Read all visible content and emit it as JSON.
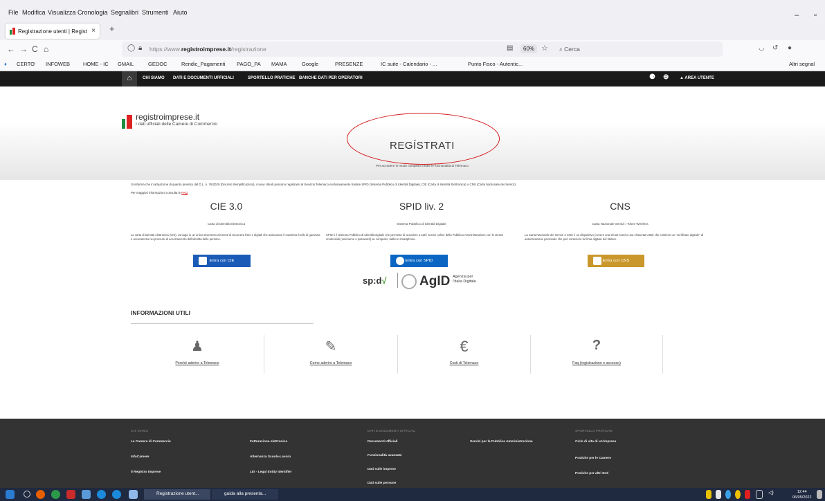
{
  "menu": [
    "File",
    "Modifica",
    "Visualizza",
    "Cronologia",
    "Segnalibri",
    "Strumenti",
    "Aiuto"
  ],
  "window_controls": {
    "minimize": "–",
    "restore": "ⓘ"
  },
  "tab": {
    "title": "Registrazione utenti | Registro Imprese",
    "close": "×",
    "new": "+"
  },
  "nav": {
    "back": "←",
    "forward": "→",
    "reload": "C",
    "home": "⌂",
    "url_prefix": "https://www.",
    "url_host": "registroimprese.it",
    "url_path": "/registrazione",
    "zoom": "60%",
    "search_placeholder": "Cerca"
  },
  "bookmarks": [
    "CERTO'",
    "INFOWEB",
    "HOME - IC",
    "GMAIL",
    "GEDOC",
    "Rendic_Pagamenti",
    "PAGO_PA",
    "MAMA",
    "Google",
    "PRESENZE",
    "IC suite - Calendario - ...",
    "Punto Fisco - Autentic..."
  ],
  "bookmarks_other": "Altri segnal",
  "site_nav": {
    "items": [
      "CHI SIAMO",
      "DATI E DOCUMENTI UFFICIALI",
      "SPORTELLO PRATICHE",
      "BANCHE DATI PER OPERATORI"
    ],
    "area": "AREA UTENTE"
  },
  "logo": {
    "name": "registroimprese.it",
    "tagline": "I dati ufficiali delle Camere di Commercio"
  },
  "hero": {
    "title": "REGÍSTRATI",
    "subtitle": "Per accedere in modo completo a tutte le funzionalità di Telemaco"
  },
  "info": {
    "line1": "Si informa che in attuazione di quanto previsto dal D.L. n. 76/2020 (Decreto Semplificazioni), i nuovi Utenti possono registrarsi al Servizio Telemaco esclusivamente tramite SPID (Sistema Pubblico di Identità Digitale), CIE (Carta di Identità Elettronica) o CNS (Carta Nazionale dei Servizi).",
    "line2": "Per maggiori informazioni consulta le",
    "faq": "FAQ"
  },
  "methods": [
    {
      "title": "CIE 3.0",
      "subtitle": "Carta di Identità Elettronica",
      "desc": "La carta di identità elettronica (CIE), coniuga in un unico strumento elementi di sicurezza fisici e digitali che assicurano il massimo livello di garanzia e accuratezza nei processi di accertamento dell'identità delle persone.",
      "button": "Entra con CIE",
      "color": "#1a5bb8"
    },
    {
      "title": "SPID liv. 2",
      "subtitle": "Sistema Pubblico di Identità Digitale",
      "desc": "SPID è il Sistema Pubblico di Identità Digitale che permette di accedere a tutti i servizi online della Pubblica Amministrazione con le stesse credenziali (username e password) su computer, tablet e smartphone.",
      "button": "Entra con SPID",
      "color": "#0a66c2"
    },
    {
      "title": "CNS",
      "subtitle": "Carta Nazionale Servizi / Token Wireless",
      "desc": "La Carta Nazionale dei Servizi o CNS è un dispositivo (ovvero una Smart Card o una chiavetta USB) che contiene un \"certificato digitale\" di autenticazione personale che può contenere la firma digitale del titolare.",
      "button": "Entra con CNS",
      "color": "#c9972b"
    }
  ],
  "logos": {
    "spid": "sp:d",
    "agid": "AgID",
    "agid_sub1": "Agenzia per",
    "agid_sub2": "l'Italia Digitale"
  },
  "useful": {
    "title": "INFORMAZIONI UTILI",
    "cards": [
      {
        "label": "Perché aderire a Telemaco",
        "icon": "user-cog-icon"
      },
      {
        "label": "Come aderire a Telemaco",
        "icon": "edit-form-icon"
      },
      {
        "label": "Costi di Telemaco",
        "icon": "euro-icon"
      },
      {
        "label": "Faq (registrazione e accesso)",
        "icon": "question-icon"
      }
    ]
  },
  "footer": {
    "heads": [
      "CHI SIAMO",
      "DATI E DOCUMENTI UFFICIALI",
      "SPORTELLO PRATICHE"
    ],
    "col1": [
      "Le Camere di Commercio",
      "InfoCamere",
      "Il Registro Imprese"
    ],
    "col2": [
      "Fatturazione elettronica",
      "Alternanza Scuola-Lavoro",
      "LEI - Legal Entity Identifier"
    ],
    "col3": [
      "Documenti Ufficiali",
      "Funzionalità avanzate",
      "Dati sulle imprese",
      "Dati sulle persone"
    ],
    "col4": [
      "Servizi per la Pubblica Amministrazione"
    ],
    "col5": [
      "Ciclo di vita di un'impresa",
      "Pratiche per le Camere",
      "Pratiche per altri Enti"
    ]
  },
  "taskbar": {
    "app1": "Registrazione utent...",
    "app2": "guida alla presenta...",
    "time": "12:44",
    "date": "06/05/2022"
  }
}
